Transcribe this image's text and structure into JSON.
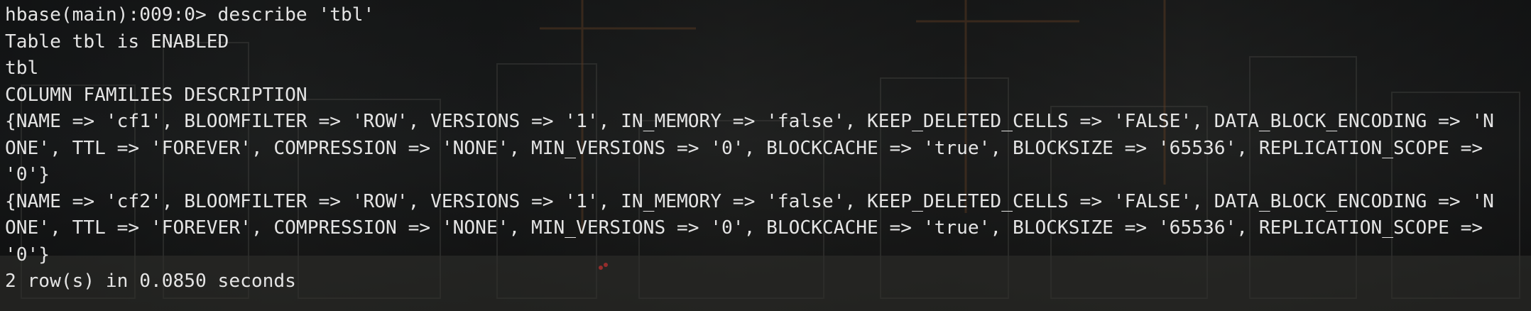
{
  "terminal": {
    "lines": [
      "hbase(main):009:0> describe 'tbl'",
      "Table tbl is ENABLED",
      "tbl",
      "COLUMN FAMILIES DESCRIPTION",
      "{NAME => 'cf1', BLOOMFILTER => 'ROW', VERSIONS => '1', IN_MEMORY => 'false', KEEP_DELETED_CELLS => 'FALSE', DATA_BLOCK_ENCODING => 'N",
      "ONE', TTL => 'FOREVER', COMPRESSION => 'NONE', MIN_VERSIONS => '0', BLOCKCACHE => 'true', BLOCKSIZE => '65536', REPLICATION_SCOPE =>",
      "'0'}",
      "{NAME => 'cf2', BLOOMFILTER => 'ROW', VERSIONS => '1', IN_MEMORY => 'false', KEEP_DELETED_CELLS => 'FALSE', DATA_BLOCK_ENCODING => 'N",
      "ONE', TTL => 'FOREVER', COMPRESSION => 'NONE', MIN_VERSIONS => '0', BLOCKCACHE => 'true', BLOCKSIZE => '65536', REPLICATION_SCOPE =>",
      "'0'}",
      "2 row(s) in 0.0850 seconds"
    ]
  },
  "colors": {
    "text": "#e4e4e4",
    "background": "#0c0d0e"
  }
}
